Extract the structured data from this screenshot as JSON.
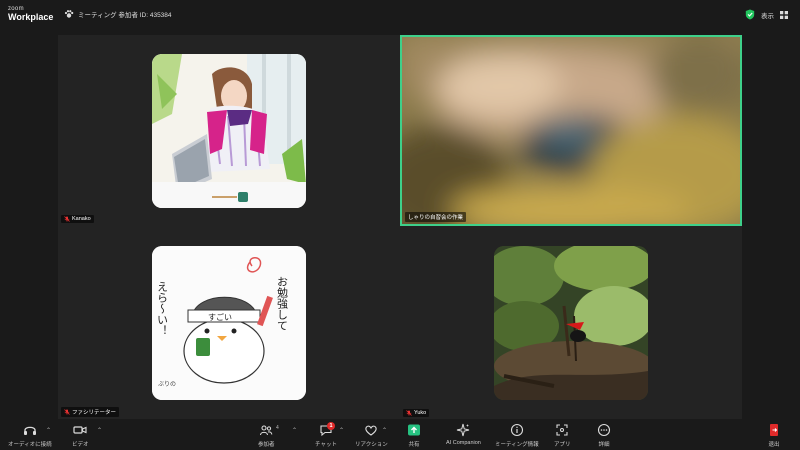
{
  "app": {
    "logo_line1": "zoom",
    "logo_line2": "Workplace"
  },
  "meeting": {
    "info": "ミーティング 参加者 ID: 435384"
  },
  "header": {
    "view_label": "表示"
  },
  "tiles": [
    {
      "name": "Kanako",
      "muted": true
    },
    {
      "name": "しゃりの自習会の作業",
      "muted": false,
      "active_speaker": true
    },
    {
      "name": "ファシリテーター",
      "muted": true
    },
    {
      "name": "Yuko",
      "muted": true
    }
  ],
  "doodle": {
    "text_right": "お勉強して",
    "text_left": "えら〜い！",
    "headband": "すごい",
    "signature": "ぶりの"
  },
  "toolbar": {
    "audio": "オーディオに接続",
    "video": "ビデオ",
    "participants": "参加者",
    "participants_count": "4",
    "chat": "チャット",
    "chat_badge": "1",
    "reactions": "リアクション",
    "share": "共有",
    "ai": "AI Companion",
    "info": "ミーティング情報",
    "apps": "アプリ",
    "more": "詳細",
    "leave": "退出"
  },
  "colors": {
    "active_border": "#3ed08a",
    "share_green": "#26c281",
    "leave_red": "#e02a2a",
    "shield": "#22c55e"
  }
}
